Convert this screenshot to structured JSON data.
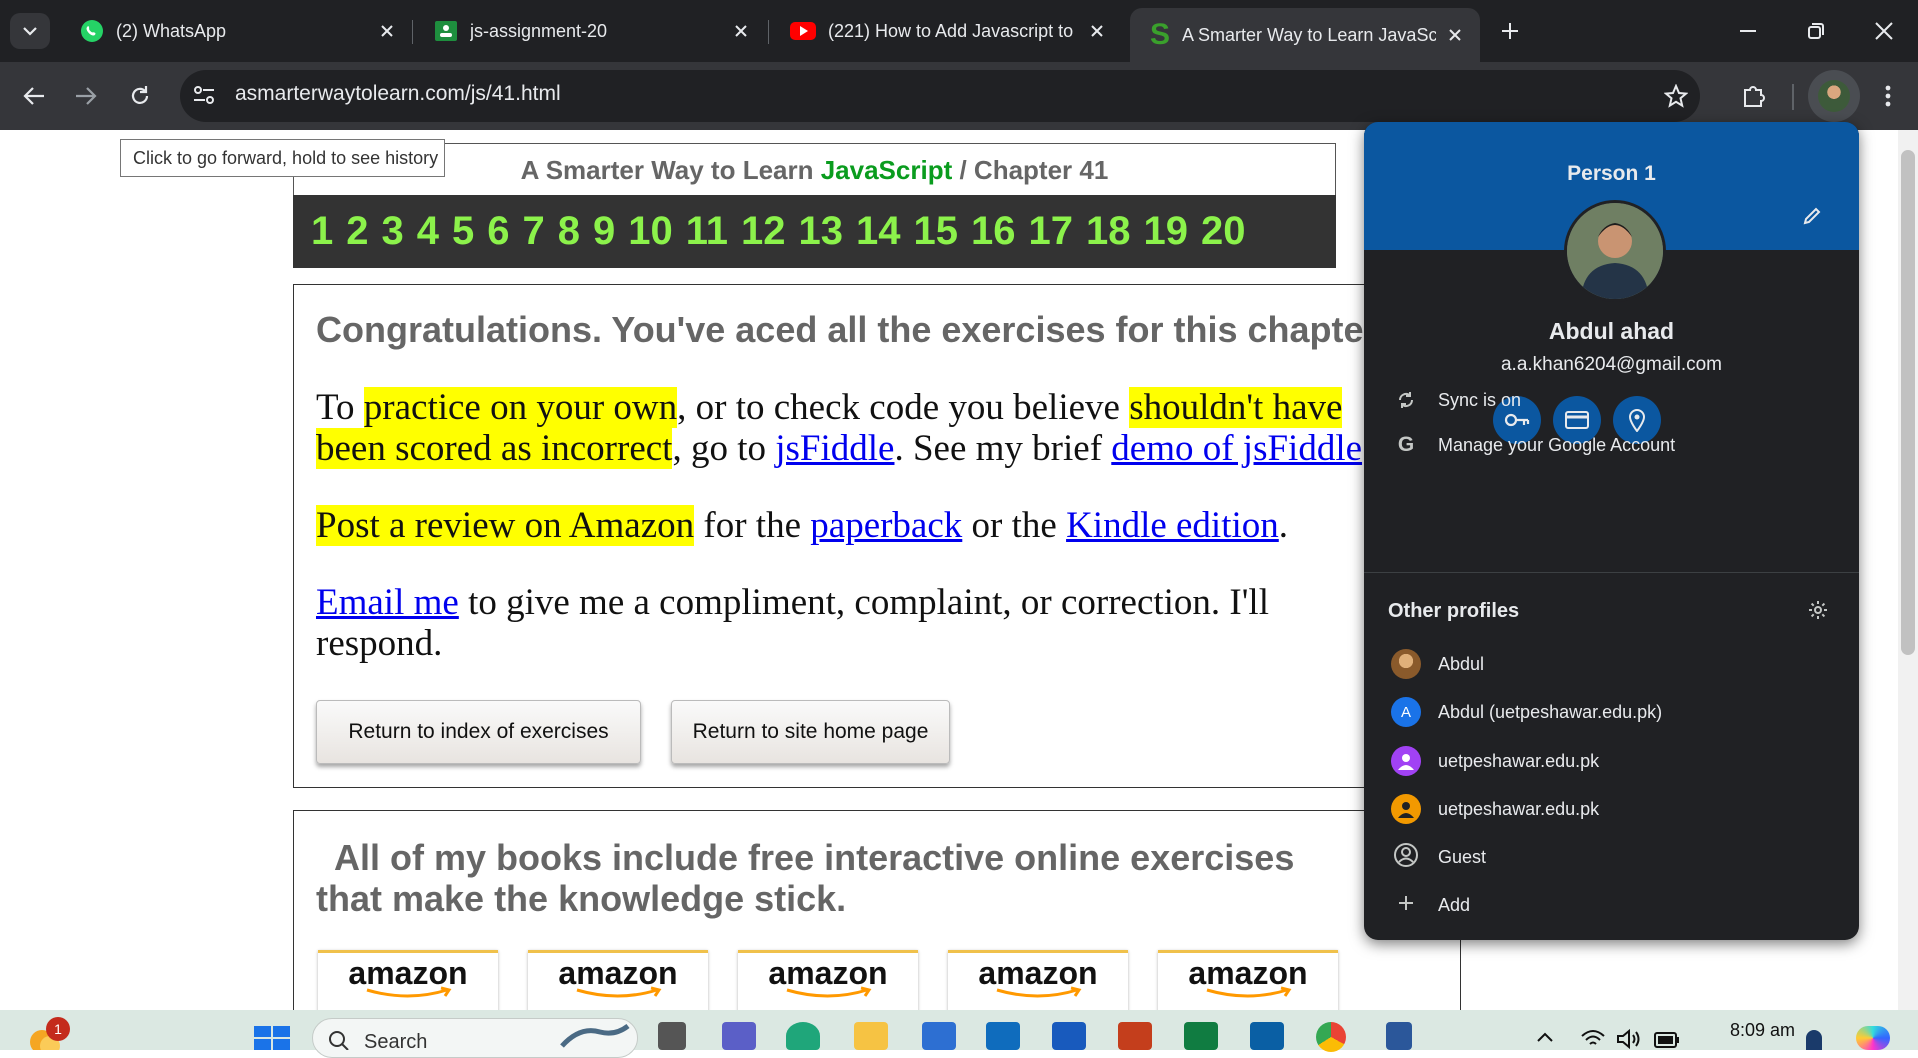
{
  "tabs": [
    {
      "title": "(2) WhatsApp",
      "icon": "whatsapp-icon",
      "color": "#25d366"
    },
    {
      "title": "js-assignment-20",
      "icon": "classroom-icon",
      "color": "#1e8e3e"
    },
    {
      "title": "(221) How to Add Javascript to",
      "icon": "youtube-icon",
      "color": "#ff0000"
    },
    {
      "title": "A Smarter Way to Learn JavaScr",
      "icon": "smarter-way-s-icon",
      "color": "#3aa02c"
    }
  ],
  "address": {
    "url": "asmarterwaytolearn.com/js/41.html"
  },
  "tooltip": "Click to go forward, hold to see history",
  "site": {
    "title_prefix": "A Smarter Way to Learn ",
    "title_js": "JavaScript",
    "title_suffix": " / Chapter 41",
    "chapters": [
      "1",
      "2",
      "3",
      "4",
      "5",
      "6",
      "7",
      "8",
      "9",
      "10",
      "11",
      "12",
      "13",
      "14",
      "15",
      "16",
      "17",
      "18",
      "19",
      "20"
    ]
  },
  "main": {
    "congrats": "Congratulations. You've aced all the exercises for this chapter.",
    "p1_a": "To ",
    "p1_hl1": "practice on your own",
    "p1_b": ", or to check code you believe ",
    "p1_hl2": "shouldn't have",
    "p1_hl3": "been scored as incorrect",
    "p1_c": ", go to ",
    "p1_link1": "jsFiddle",
    "p1_d": ". See my brief ",
    "p1_link2": "demo of jsFiddle",
    "p2_hl": "Post a review on Amazon",
    "p2_a": " for the ",
    "p2_link1": "paperback",
    "p2_b": " or the ",
    "p2_link2": "Kindle edition",
    "p2_c": ".",
    "p3_link": "Email me",
    "p3_text": " to give me a compliment, complaint, or correction. I'll respond.",
    "btn_index": "Return to index of exercises",
    "btn_home": "Return to site home page"
  },
  "books": {
    "text": "All of my books include free interactive online exercises that make the knowledge stick.",
    "amazon_label": "amazon"
  },
  "profile": {
    "header": "Person 1",
    "name": "Abdul ahad",
    "email": "a.a.khan6204@gmail.com",
    "sync": "Sync is on",
    "manage": "Manage your Google Account",
    "other_title": "Other profiles",
    "others": [
      {
        "name": "Abdul",
        "avatar": "photo",
        "color": "#a0703a"
      },
      {
        "name": "Abdul (uetpeshawar.edu.pk)",
        "avatar": "A",
        "color": "#1a73e8"
      },
      {
        "name": "uetpeshawar.edu.pk",
        "avatar": "person",
        "color": "#a142f4"
      },
      {
        "name": "uetpeshawar.edu.pk",
        "avatar": "person",
        "color": "#f29900"
      },
      {
        "name": "Guest",
        "avatar": "guest",
        "color": "#202124"
      },
      {
        "name": "Add",
        "avatar": "plus",
        "color": "#202124"
      }
    ],
    "accent": "#0b57a0"
  },
  "taskbar": {
    "search_placeholder": "Search",
    "time": "8:09 am",
    "notification_count": "1"
  }
}
